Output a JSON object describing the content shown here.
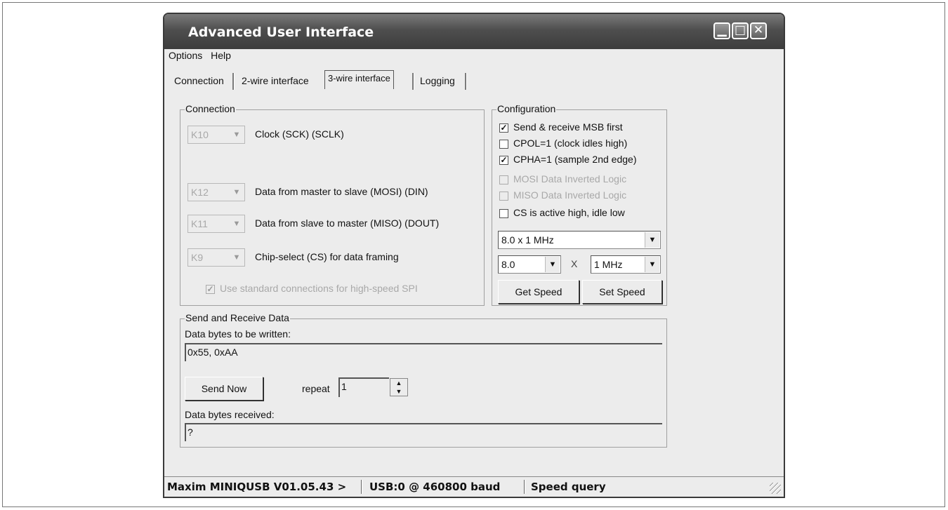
{
  "window": {
    "title": "Advanced User Interface"
  },
  "menu": [
    "Options",
    "Help"
  ],
  "tabs": [
    "Connection",
    "2-wire interface",
    "3-wire interface",
    "Logging"
  ],
  "connection": {
    "label": "Connection",
    "rows": [
      {
        "pin": "K10",
        "desc": "Clock (SCK) (SCLK)"
      },
      {
        "pin": "K12",
        "desc": "Data from master to slave (MOSI) (DIN)"
      },
      {
        "pin": "K11",
        "desc": "Data from slave to master (MISO) (DOUT)"
      },
      {
        "pin": "K9",
        "desc": "Chip-select (CS) for data framing"
      }
    ],
    "standard": {
      "label": "Use standard connections for high-speed SPI",
      "checked": true,
      "enabled": false
    }
  },
  "configuration": {
    "label": "Configuration",
    "options": [
      {
        "label": "Send & receive MSB first",
        "checked": true,
        "enabled": true
      },
      {
        "label": "CPOL=1 (clock idles high)",
        "checked": false,
        "enabled": true
      },
      {
        "label": "CPHA=1 (sample 2nd edge)",
        "checked": true,
        "enabled": true
      },
      {
        "label": "MOSI Data Inverted Logic",
        "checked": false,
        "enabled": false
      },
      {
        "label": "MISO Data Inverted Logic",
        "checked": false,
        "enabled": false
      },
      {
        "label": "CS is active high, idle low",
        "checked": false,
        "enabled": true
      }
    ],
    "speed": "8.0 x 1 MHz",
    "multiplier": "8.0",
    "times": "X",
    "unit": "1 MHz",
    "get_speed": "Get Speed",
    "set_speed": "Set Speed"
  },
  "send_receive": {
    "label": "Send and Receive Data",
    "written_label": "Data bytes to be written:",
    "written_value": "0x55, 0xAA",
    "send_now": "Send Now",
    "repeat_label": "repeat",
    "repeat_value": "1",
    "received_label": "Data bytes received:",
    "received_value": "?"
  },
  "status": {
    "device": "Maxim MINIQUSB V01.05.43 >",
    "port": "USB:0 @ 460800 baud",
    "message": "Speed query"
  }
}
